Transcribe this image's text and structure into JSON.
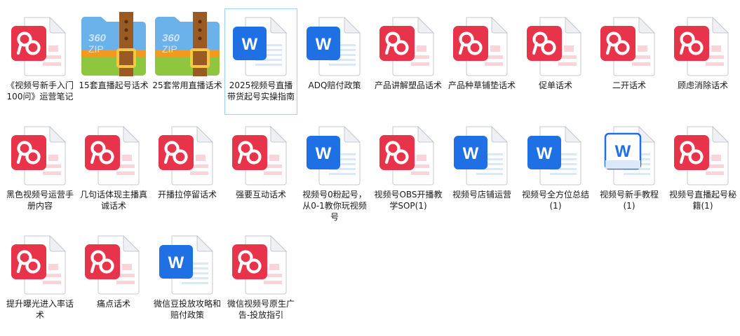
{
  "files": [
    {
      "name": "《视频号新手入门100问》运营笔记",
      "type": "pdf",
      "icon": "pdf-file-icon"
    },
    {
      "name": "15套直播起号话术",
      "type": "zip",
      "icon": "zip-archive-icon",
      "zip_brand": "360",
      "zip_text": "ZIP"
    },
    {
      "name": "25套常用直播话术",
      "type": "zip",
      "icon": "zip-archive-icon",
      "zip_brand": "360",
      "zip_text": "ZIP"
    },
    {
      "name": "2025视频号直播带货起号实操指南",
      "type": "word",
      "icon": "word-doc-icon",
      "selected": true,
      "glyph": "W"
    },
    {
      "name": "ADQ赔付政策",
      "type": "word",
      "icon": "word-doc-icon",
      "glyph": "W"
    },
    {
      "name": "产品讲解塑品话术",
      "type": "pdf",
      "icon": "pdf-file-icon"
    },
    {
      "name": "产品种草铺垫话术",
      "type": "pdf",
      "icon": "pdf-file-icon"
    },
    {
      "name": "促单话术",
      "type": "pdf",
      "icon": "pdf-file-icon"
    },
    {
      "name": "二开话术",
      "type": "pdf",
      "icon": "pdf-file-icon"
    },
    {
      "name": "顾虑消除话术",
      "type": "pdf",
      "icon": "pdf-file-icon"
    },
    {
      "name": "黑色视频号运营手册内容",
      "type": "pdf",
      "icon": "pdf-file-icon"
    },
    {
      "name": "几句话体现主播真诚话术",
      "type": "pdf",
      "icon": "pdf-file-icon"
    },
    {
      "name": "开播拉停留话术",
      "type": "pdf",
      "icon": "pdf-file-icon"
    },
    {
      "name": "强要互动话术",
      "type": "pdf",
      "icon": "pdf-file-icon"
    },
    {
      "name": "视频号0粉起号，从0-1教你玩视频号",
      "type": "word",
      "icon": "word-doc-icon",
      "glyph": "W"
    },
    {
      "name": "视频号OBS开播教学SOP(1)",
      "type": "pdf",
      "icon": "pdf-file-icon"
    },
    {
      "name": "视频号店铺运营",
      "type": "word",
      "icon": "word-doc-icon",
      "glyph": "W"
    },
    {
      "name": "视频号全方位总结(1)",
      "type": "word",
      "icon": "word-doc-icon",
      "glyph": "W"
    },
    {
      "name": "视频号新手教程(1)",
      "type": "word-old",
      "icon": "word-doc-icon",
      "glyph": "W"
    },
    {
      "name": "视频号直播起号秘籍(1)",
      "type": "pdf",
      "icon": "pdf-file-icon"
    },
    {
      "name": "提升曝光进入率话术",
      "type": "pdf",
      "icon": "pdf-file-icon"
    },
    {
      "name": "痛点话术",
      "type": "pdf",
      "icon": "pdf-file-icon"
    },
    {
      "name": "微信豆投放攻略和赔付政策",
      "type": "word",
      "icon": "word-doc-icon",
      "glyph": "W"
    },
    {
      "name": "微信视频号原生广告-投放指引",
      "type": "pdf",
      "icon": "pdf-file-icon"
    }
  ],
  "colors": {
    "pdf_red": "#e8344a",
    "word_blue": "#1f6fe5",
    "zip_blue": "#6bb2ea",
    "zip_green": "#8fc63f",
    "zip_orange": "#f39a1e",
    "zip_strap": "#9a5a24",
    "selection_border": "#99d1ff"
  }
}
